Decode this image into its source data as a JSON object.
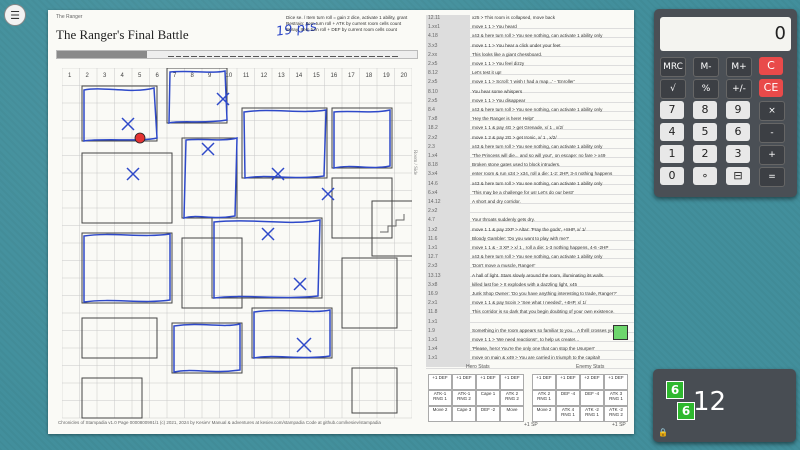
{
  "app": {
    "menu_icon": "hamburger-icon"
  },
  "sheet": {
    "header_left": "The Ranger",
    "title": "The Ranger's Final Battle",
    "handwritten_score": "19 pts",
    "rules": [
      "Dice se. / Item turn roll = gain 2 dice, activate 1 ability, grant",
      "Restrain: Item turn roll + ATK by current room cells count",
      "Spray: Item turn roll + DEF by current room cells count"
    ],
    "progress_fraction": 0.25,
    "footer": "Chronicles of Stampadia v1.0   Page 0000800991/1   (c) 2021, 2024 by KesieV   Manual & adventures at kesiev.com/stampadia   Code at github.com/kesiev/stampadia",
    "sidebar_label": "Room / Side",
    "row_labels": [
      "1",
      "2",
      "3",
      "4",
      "5",
      "6",
      "7",
      "8",
      "9",
      "10",
      "11",
      "12",
      "13",
      "14",
      "15",
      "16",
      "17",
      "18",
      "19",
      "20"
    ],
    "col_labels": [
      "1",
      "2",
      "3",
      "4",
      "5",
      "6",
      "7",
      "8",
      "9",
      "10",
      "11",
      "12",
      "13",
      "14",
      "15",
      "16",
      "17",
      "18",
      "19",
      "20"
    ]
  },
  "log": [
    {
      "num": "12.11",
      "text": "x25 > This room is collapsed, move back"
    },
    {
      "num": "1.xx1",
      "text": "move 1 1 > You heard"
    },
    {
      "num": "4.18",
      "text": "x43 & here turn roll > You see nothing, can activate 1 ability only"
    },
    {
      "num": "3.x3",
      "text": "move 1 1 > You hear a click under your feet"
    },
    {
      "num": "2.xx",
      "text": "This looks like a giant chessboard."
    },
    {
      "num": "2.x5",
      "text": "move 1 1 > You feel dizzy"
    },
    {
      "num": "8.12",
      "text": "Let's test it up!"
    },
    {
      "num": "2.x5",
      "text": "move 1 1 > Scroll: 'I wish I had a map...' - 'Enroller'"
    },
    {
      "num": "8.10",
      "text": "You hear some whispers"
    },
    {
      "num": "2.x5",
      "text": "move 1 1 > You disappear"
    },
    {
      "num": "8.4",
      "text": "x43 & here turn roll > You see nothing, can activate 1 ability only"
    },
    {
      "num": "7.x8",
      "text": "'Hey the Ranger is here! Help!'"
    },
    {
      "num": "18.2",
      "text": "move 1 1 & pay 4G > get Grenade, x/ 1 , x/2/"
    },
    {
      "num": "2.x2",
      "text": "move 1 2 & pay 2G > get Ironic, x/ 1 , x/2/"
    },
    {
      "num": "2.3",
      "text": "x43 & here turn roll > You see nothing, can activate 1 ability only"
    },
    {
      "num": "1.x4",
      "text": "'The Princess will die... and so will you!', on escape: no fare > x49"
    },
    {
      "num": "8.18",
      "text": "Broken stone gates used to block intruders."
    },
    {
      "num": "3.x4",
      "text": "enter room & run x34 > x34, roll a die: 1-2: 2HP, 3-4 nothing happens"
    },
    {
      "num": "14.6",
      "text": "x43 & here turn roll > You see nothing, can activate 1 ability only"
    },
    {
      "num": "6.x4",
      "text": "'This may be a challenge for us! Let's do our best!'"
    },
    {
      "num": "14.12",
      "text": "A short and dry corridor."
    },
    {
      "num": "2.x2",
      "text": ""
    },
    {
      "num": "4.7",
      "text": "Your throats suddenly gets dry."
    },
    {
      "num": "1.x2",
      "text": "move 1 1 & pay 2XP > Altar: 'Pray the gods', +8HP, x/ 1/"
    },
    {
      "num": "11.6",
      "text": "Bloody Gambler: 'Do you want to play with me?'"
    },
    {
      "num": "1.x1",
      "text": "move 1 1 & - 3 XP > x/ 1 , roll a die: 1-3 nothing happens, 4-6 -2HP"
    },
    {
      "num": "12.7",
      "text": "x43 & here turn roll > You see nothing, can activate 1 ability only"
    },
    {
      "num": "2.x3",
      "text": "'Don't move a muscle, Ranger!'"
    },
    {
      "num": "13.13",
      "text": "A hall of light. Stars slowly around the room, illuminating its walls."
    },
    {
      "num": "3.x8",
      "text": "killed last foe > It explodes with a dazzling light, x45"
    },
    {
      "num": "16.9",
      "text": "Junk Shop Owner: 'Do you have anything interesting to trade, Ranger?'"
    },
    {
      "num": "2.x1",
      "text": "move 1 1 & pay 5coin > 'See what I needed', +4HP, x/ 1/"
    },
    {
      "num": "11.8",
      "text": "This corridor is so dark that you begin doubting of your own existence."
    },
    {
      "num": "1.x1",
      "text": ""
    },
    {
      "num": "1.9",
      "text": "Something in the room appears so familiar to you... A thrill crosses your skin"
    },
    {
      "num": "1.x1",
      "text": "move 1 1 > 'We need reactions!', to help us create!..."
    },
    {
      "num": "1.x4",
      "text": "'Please, hero! You're the only one that can stop the Usurper!'"
    },
    {
      "num": "1.x1",
      "text": "move on main & x49 > You are carried in triumph to the capital!"
    }
  ],
  "stats": {
    "hero_title": "Hero Stats",
    "enemy_title": "Enemy Stats",
    "hero_boxes": [
      "+1 DEF",
      "+1 DEF",
      "+1 DEF",
      "+1 DEF",
      "ATK-1 RNG 1",
      "ATK-1 RNG 2",
      "Cape 1",
      "ATK 2 RNG 2",
      "Move 2",
      "Cape 3",
      "DEF -2",
      "Move"
    ],
    "enemy_boxes": [
      "+1 DEF",
      "+1 DEF",
      "+2 DEF",
      "+1 DEF",
      "ATK 2 RNG 1",
      "DEF -4",
      "DEF -4",
      "ATK 3 RNG 1",
      "Move 2",
      "ATK 4 RNG 1",
      "ATK -2 RNG 1",
      "ATK -2 RNG 2"
    ],
    "hero_sp": "+1 SP",
    "enemy_sp": "+1 SP"
  },
  "calculator": {
    "display": "0",
    "rows": [
      [
        "MRC",
        "M-",
        "M+",
        "C"
      ],
      [
        "√",
        "%",
        "+/-",
        "CE"
      ],
      [
        "7",
        "8",
        "9",
        "×"
      ],
      [
        "4",
        "5",
        "6",
        "-"
      ],
      [
        "1",
        "2",
        "3",
        "+"
      ],
      [
        "0",
        "∘",
        "⊟",
        "="
      ]
    ]
  },
  "dice": {
    "die1": "6",
    "die2": "6",
    "total": "12",
    "lock_icon": "lock-icon"
  }
}
